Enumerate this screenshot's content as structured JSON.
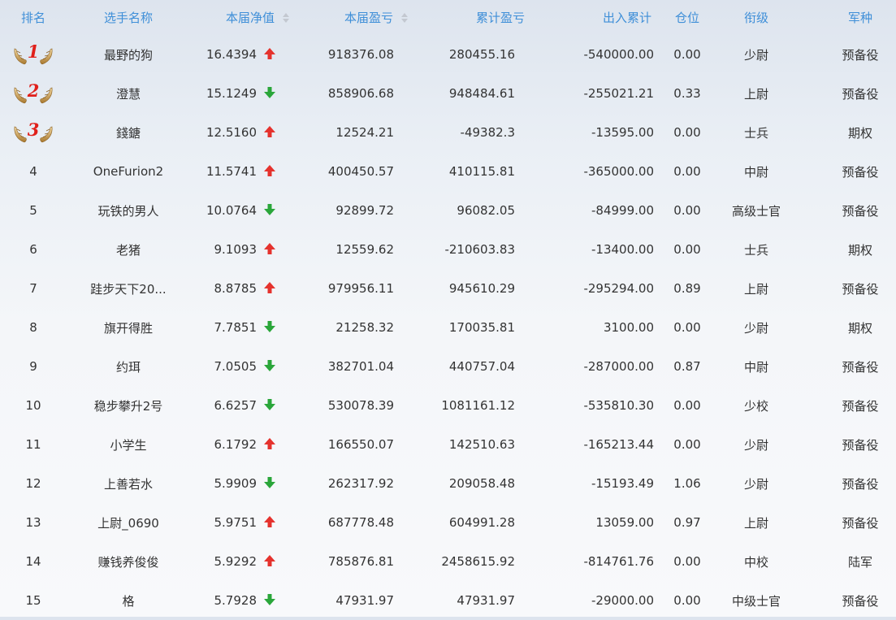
{
  "columns": {
    "rank": "排名",
    "name": "选手名称",
    "net_value": "本届净值",
    "profit": "本届盈亏",
    "total_profit": "累计盈亏",
    "inout": "出入累计",
    "position": "仓位",
    "grade": "衔级",
    "branch": "军种"
  },
  "colors": {
    "header_text": "#3f8fd8",
    "up_arrow": "#e5322d",
    "down_arrow": "#2aa63a",
    "medal_number": "#e0201b"
  },
  "icons": {
    "up": "arrow-up-icon",
    "down": "arrow-down-icon",
    "medal": "laurel-wings-icon",
    "sort": "sort-caret-icon"
  },
  "rows": [
    {
      "rank": "1",
      "name": "最野的狗",
      "net_value": "16.4394",
      "trend": "up",
      "profit": "918376.08",
      "total_profit": "280455.16",
      "inout": "-540000.00",
      "position": "0.00",
      "grade": "少尉",
      "branch": "预备役"
    },
    {
      "rank": "2",
      "name": "澄慧",
      "net_value": "15.1249",
      "trend": "down",
      "profit": "858906.68",
      "total_profit": "948484.61",
      "inout": "-255021.21",
      "position": "0.33",
      "grade": "上尉",
      "branch": "预备役"
    },
    {
      "rank": "3",
      "name": "錢鎕",
      "net_value": "12.5160",
      "trend": "up",
      "profit": "12524.21",
      "total_profit": "-49382.3",
      "inout": "-13595.00",
      "position": "0.00",
      "grade": "士兵",
      "branch": "期权"
    },
    {
      "rank": "4",
      "name": "OneFurion2",
      "net_value": "11.5741",
      "trend": "up",
      "profit": "400450.57",
      "total_profit": "410115.81",
      "inout": "-365000.00",
      "position": "0.00",
      "grade": "中尉",
      "branch": "预备役"
    },
    {
      "rank": "5",
      "name": "玩铁的男人",
      "net_value": "10.0764",
      "trend": "down",
      "profit": "92899.72",
      "total_profit": "96082.05",
      "inout": "-84999.00",
      "position": "0.00",
      "grade": "高级士官",
      "branch": "预备役"
    },
    {
      "rank": "6",
      "name": "老猪",
      "net_value": "9.1093",
      "trend": "up",
      "profit": "12559.62",
      "total_profit": "-210603.83",
      "inout": "-13400.00",
      "position": "0.00",
      "grade": "士兵",
      "branch": "期权"
    },
    {
      "rank": "7",
      "name": "跬步天下20...",
      "net_value": "8.8785",
      "trend": "up",
      "profit": "979956.11",
      "total_profit": "945610.29",
      "inout": "-295294.00",
      "position": "0.89",
      "grade": "上尉",
      "branch": "预备役"
    },
    {
      "rank": "8",
      "name": "旗开得胜",
      "net_value": "7.7851",
      "trend": "down",
      "profit": "21258.32",
      "total_profit": "170035.81",
      "inout": "3100.00",
      "position": "0.00",
      "grade": "少尉",
      "branch": "期权"
    },
    {
      "rank": "9",
      "name": "约珥",
      "net_value": "7.0505",
      "trend": "down",
      "profit": "382701.04",
      "total_profit": "440757.04",
      "inout": "-287000.00",
      "position": "0.87",
      "grade": "中尉",
      "branch": "预备役"
    },
    {
      "rank": "10",
      "name": "稳步攀升2号",
      "net_value": "6.6257",
      "trend": "down",
      "profit": "530078.39",
      "total_profit": "1081161.12",
      "inout": "-535810.30",
      "position": "0.00",
      "grade": "少校",
      "branch": "预备役"
    },
    {
      "rank": "11",
      "name": "小学生",
      "net_value": "6.1792",
      "trend": "up",
      "profit": "166550.07",
      "total_profit": "142510.63",
      "inout": "-165213.44",
      "position": "0.00",
      "grade": "少尉",
      "branch": "预备役"
    },
    {
      "rank": "12",
      "name": "上善若水",
      "net_value": "5.9909",
      "trend": "down",
      "profit": "262317.92",
      "total_profit": "209058.48",
      "inout": "-15193.49",
      "position": "1.06",
      "grade": "少尉",
      "branch": "预备役"
    },
    {
      "rank": "13",
      "name": "上尉_0690",
      "net_value": "5.9751",
      "trend": "up",
      "profit": "687778.48",
      "total_profit": "604991.28",
      "inout": "13059.00",
      "position": "0.97",
      "grade": "上尉",
      "branch": "预备役"
    },
    {
      "rank": "14",
      "name": "赚钱养俊俊",
      "net_value": "5.9292",
      "trend": "up",
      "profit": "785876.81",
      "total_profit": "2458615.92",
      "inout": "-814761.76",
      "position": "0.00",
      "grade": "中校",
      "branch": "陆军"
    },
    {
      "rank": "15",
      "name": "格",
      "net_value": "5.7928",
      "trend": "down",
      "profit": "47931.97",
      "total_profit": "47931.97",
      "inout": "-29000.00",
      "position": "0.00",
      "grade": "中级士官",
      "branch": "预备役"
    }
  ]
}
